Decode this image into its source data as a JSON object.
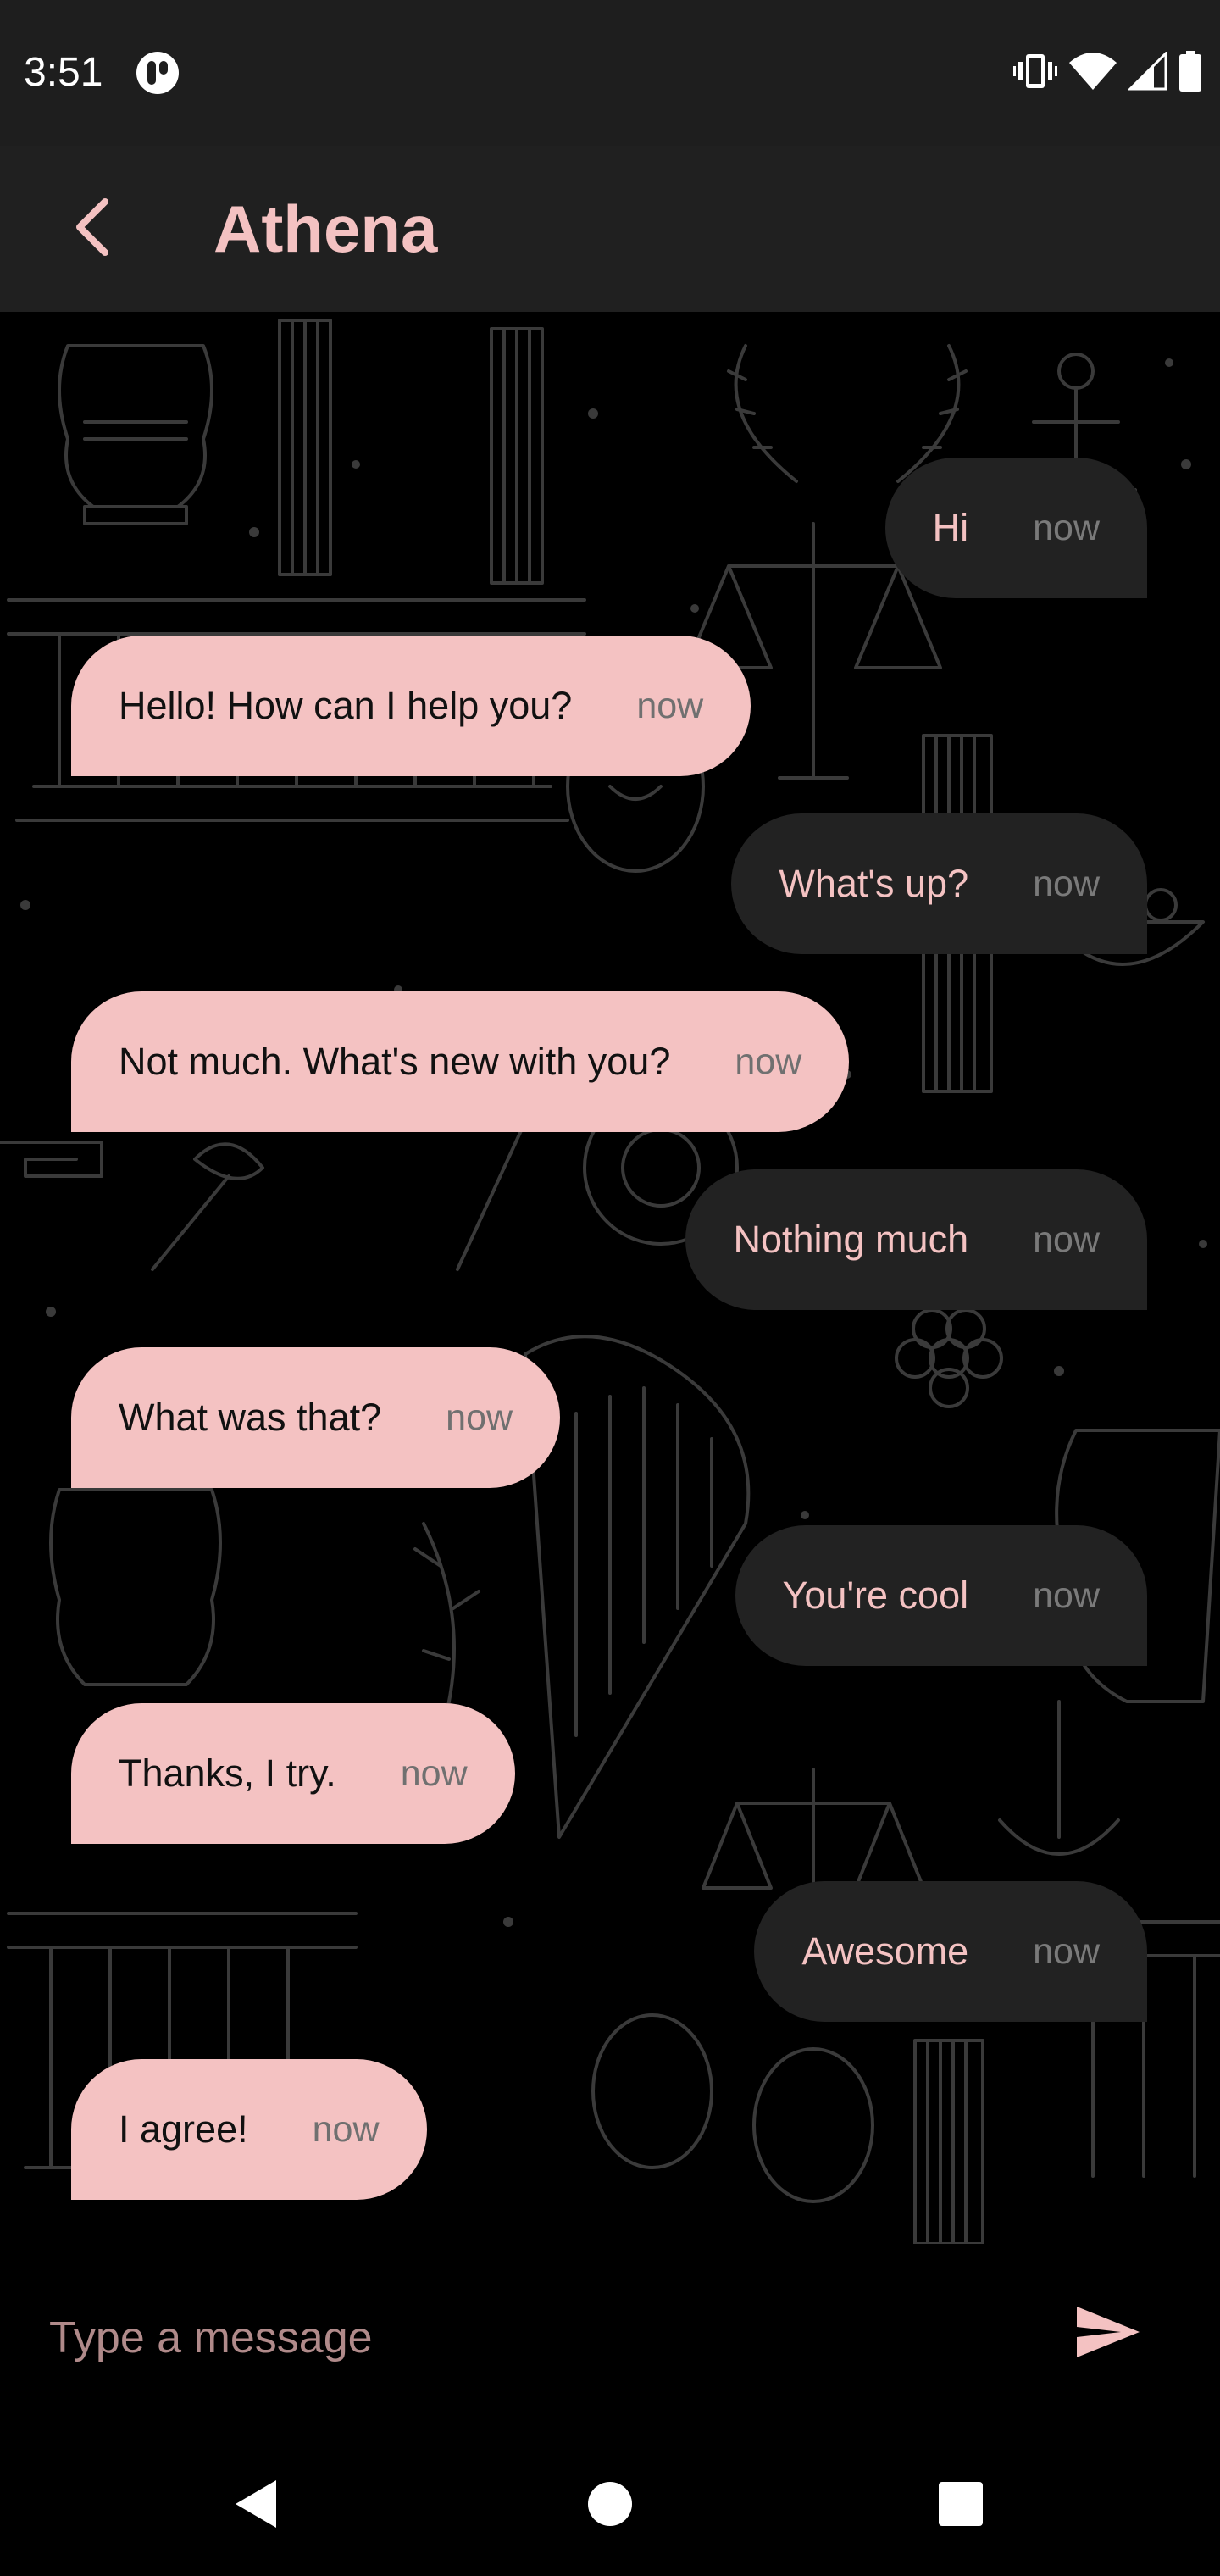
{
  "status_bar": {
    "time": "3:51",
    "app_icon": "app-notification-icon",
    "icons": [
      "vibrate-icon",
      "wifi-icon",
      "signal-icon",
      "battery-icon"
    ]
  },
  "app_bar": {
    "back_icon": "chevron-left-icon",
    "title": "Athena"
  },
  "messages": [
    {
      "direction": "out",
      "text": "Hi",
      "time": "now"
    },
    {
      "direction": "in",
      "text": "Hello! How can I help you?",
      "time": "now"
    },
    {
      "direction": "out",
      "text": "What's up?",
      "time": "now"
    },
    {
      "direction": "in",
      "text": "Not much. What's new with you?",
      "time": "now"
    },
    {
      "direction": "out",
      "text": "Nothing much",
      "time": "now"
    },
    {
      "direction": "in",
      "text": "What was that?",
      "time": "now"
    },
    {
      "direction": "out",
      "text": "You're cool",
      "time": "now"
    },
    {
      "direction": "in",
      "text": "Thanks, I try.",
      "time": "now"
    },
    {
      "direction": "out",
      "text": "Awesome",
      "time": "now"
    },
    {
      "direction": "in",
      "text": "I agree!",
      "time": "now"
    }
  ],
  "composer": {
    "placeholder": "Type a message",
    "value": "",
    "send_icon": "send-icon"
  },
  "nav_bar": {
    "icons": [
      "back-triangle-icon",
      "home-circle-icon",
      "recents-square-icon"
    ]
  },
  "colors": {
    "accent": "#f4c2c2",
    "background": "#000000",
    "app_bar": "#202020",
    "outgoing_bubble": "#222222"
  }
}
